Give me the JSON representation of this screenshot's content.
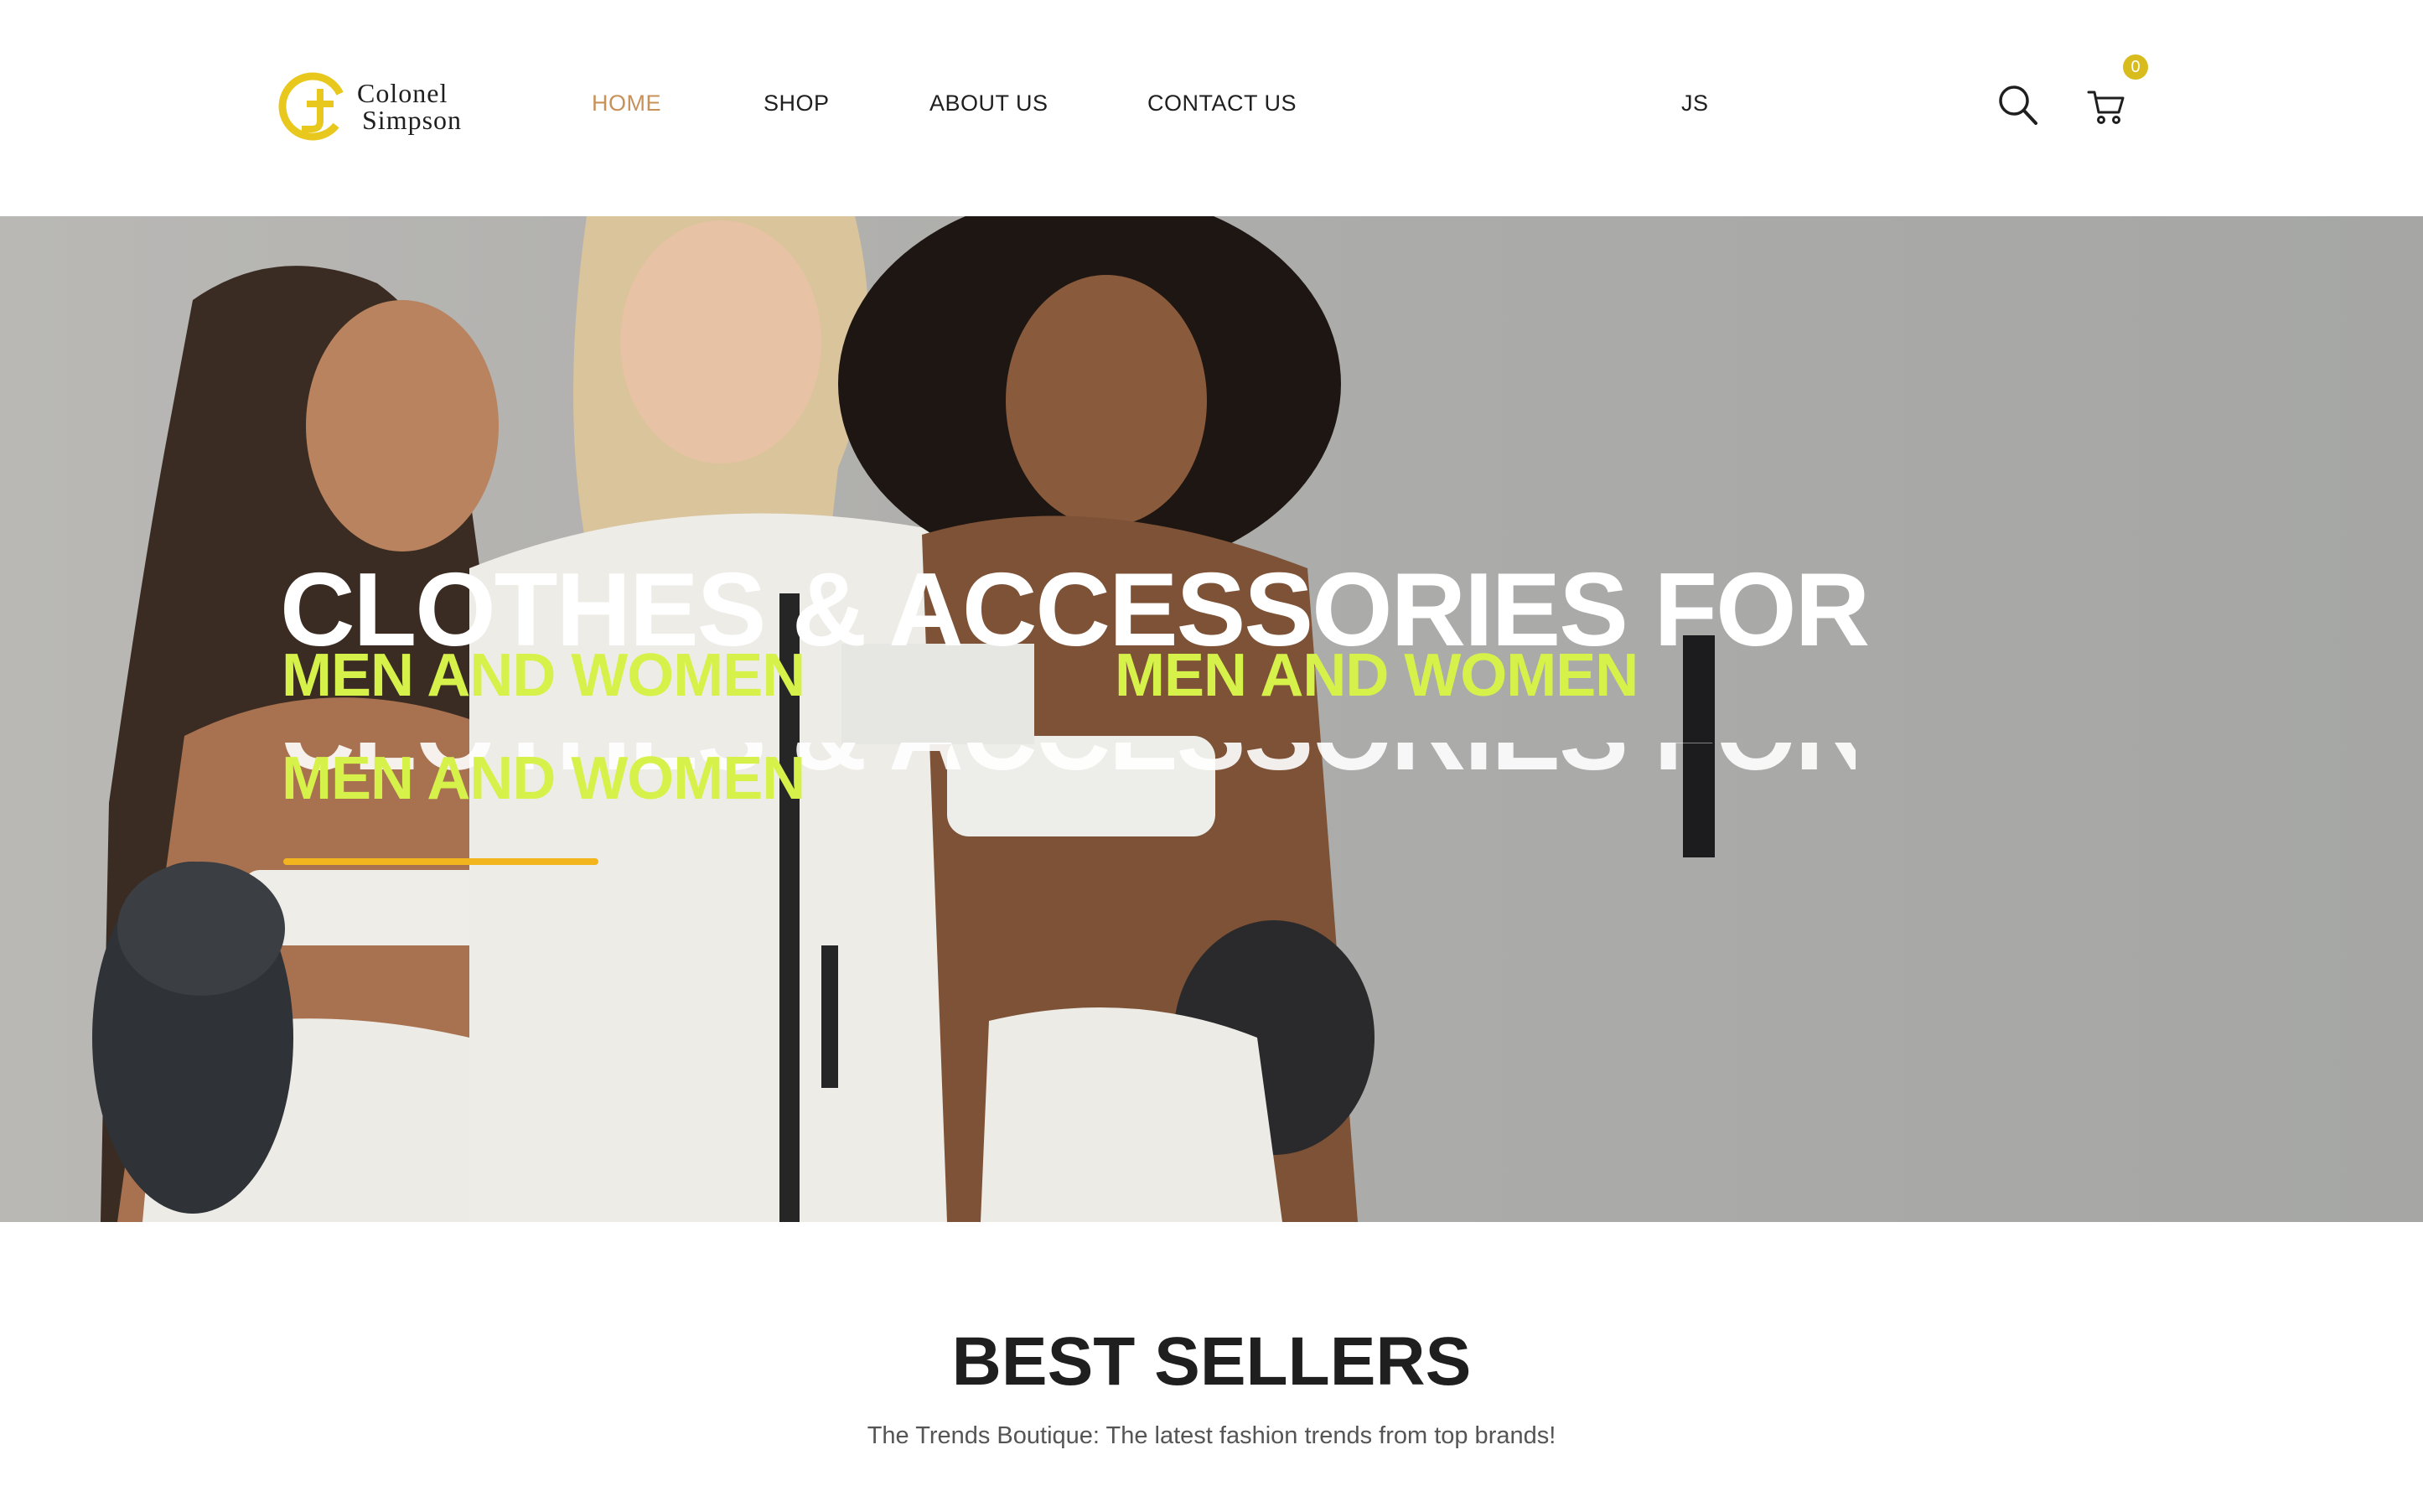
{
  "header": {
    "logo": {
      "line1": "Colonel",
      "line2": "Simpson",
      "icon": "cs-monogram-logo"
    },
    "nav": [
      {
        "label": "HOME",
        "active": true
      },
      {
        "label": "SHOP",
        "active": false
      },
      {
        "label": "ABOUT US",
        "active": false
      },
      {
        "label": "CONTACT US",
        "active": false
      }
    ],
    "stray_nav_text": "JS",
    "search_icon": "search-icon",
    "cart_icon": "cart-icon",
    "cart_count": "0",
    "colors": {
      "accent_nav": "#c8915a",
      "badge": "#d8bc1e"
    }
  },
  "hero": {
    "title": "CLOTHES & ACCESSORIES FOR",
    "subtitle": "MEN AND WOMEN",
    "colors": {
      "title": "#ffffff",
      "subtitle": "#d6f24a",
      "underline": "#f2b51d"
    }
  },
  "best_sellers": {
    "title": "BEST SELLERS",
    "subtitle": "The Trends Boutique: The latest fashion trends from top brands!"
  }
}
